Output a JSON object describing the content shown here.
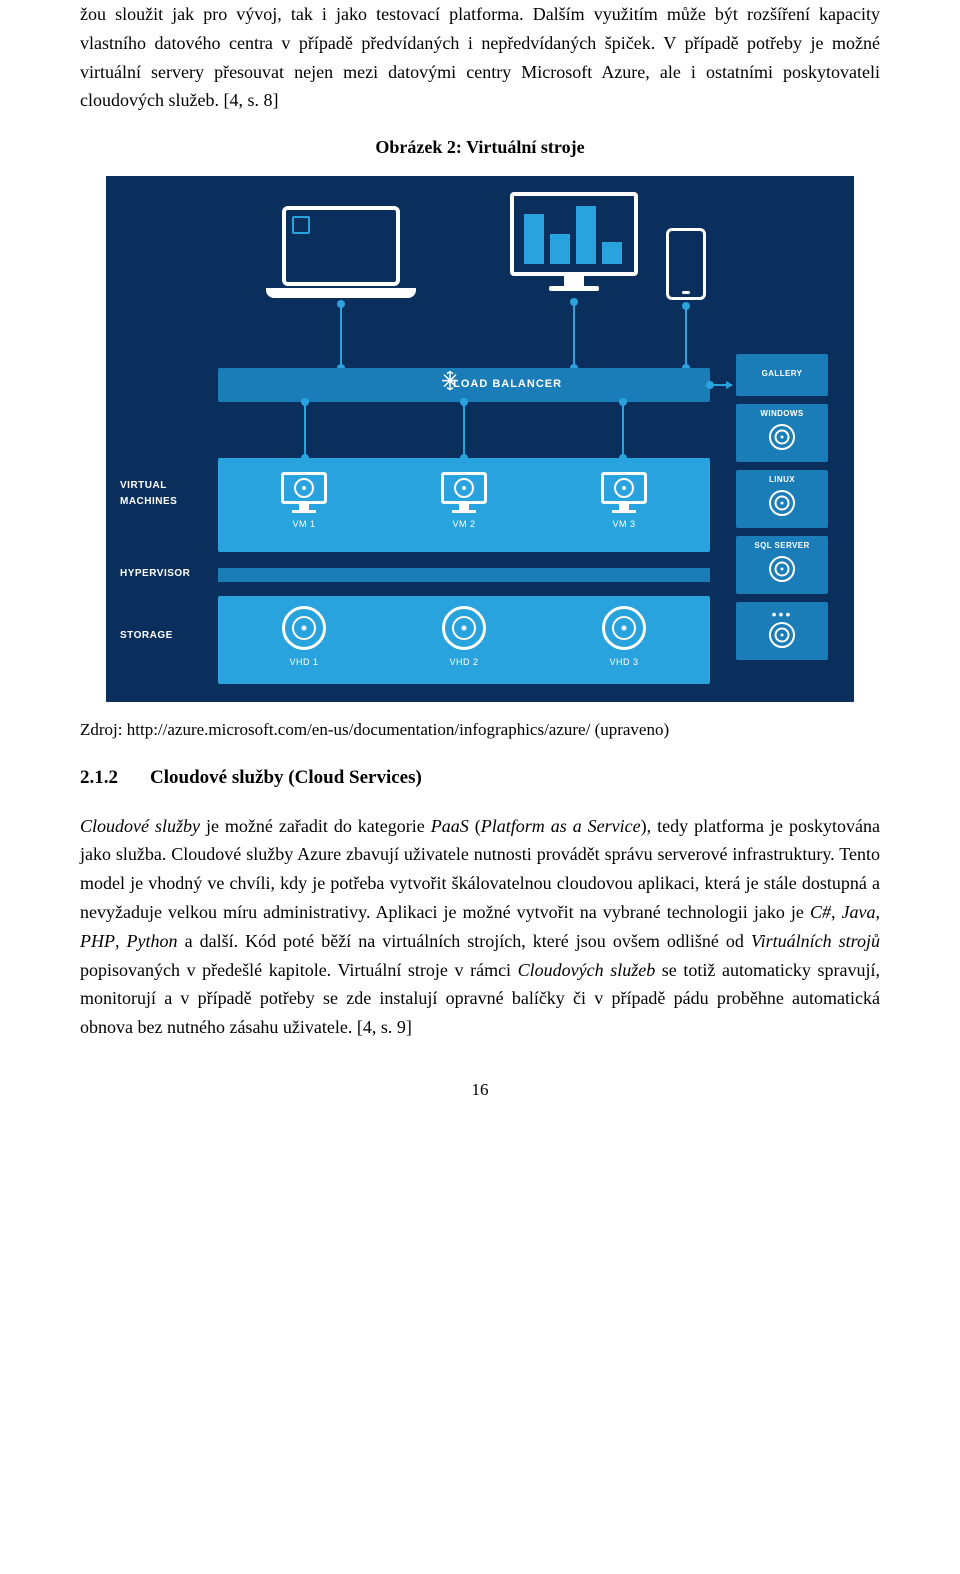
{
  "para1": "žou sloužit jak pro vývoj, tak i jako testovací platforma. Dalším využitím může být rozšíření kapacity vlastního datového centra v případě předvídaných i nepředvídaných špiček. V případě potřeby je možné virtuální servery přesouvat nejen mezi datovými centry Microsoft Azure, ale i ostatními poskytovateli cloudových služeb. [4, s. 8]",
  "fig_title": "Obrázek 2: Virtuální stroje",
  "diagram": {
    "load_balancer": "LOAD BALANCER",
    "left_labels": {
      "vm": "VIRTUAL\nMACHINES",
      "hyp": "HYPERVISOR",
      "storage": "STORAGE"
    },
    "vms": [
      "VM 1",
      "VM 2",
      "VM 3"
    ],
    "vhds": [
      "VHD 1",
      "VHD 2",
      "VHD 3"
    ],
    "side": [
      "GALLERY",
      "WINDOWS",
      "LINUX",
      "SQL SERVER",
      ""
    ]
  },
  "fig_source": "Zdroj: http://azure.microsoft.com/en-us/documentation/infographics/azure/ (upraveno)",
  "section": {
    "num": "2.1.2",
    "title": "Cloudové služby (Cloud Services)"
  },
  "para2": "Cloudové služby je možné zařadit do kategorie PaaS (Platform as a Service), tedy platforma je poskytována jako služba. Cloudové služby Azure zbavují uživatele nutnosti provádět správu serverové infrastruktury. Tento model je vhodný ve chvíli, kdy je potřeba vytvořit škálovatelnou cloudovou aplikaci, která je stále dostupná a nevyžaduje velkou míru administrativy. Aplikaci je možné vytvořit na vybrané technologii jako je C#, Java, PHP, Python a další. Kód poté běží na virtuálních strojích, které jsou ovšem odlišné od Virtuálních strojů popisovaných v předešlé kapitole. Virtuální stroje v rámci Cloudových služeb se totiž automaticky spravují, monitorují a v případě potřeby se zde instalují opravné balíčky či v případě pádu proběhne automatická obnova bez nutného zásahu uživatele. [4, s. 9]",
  "page_number": "16"
}
